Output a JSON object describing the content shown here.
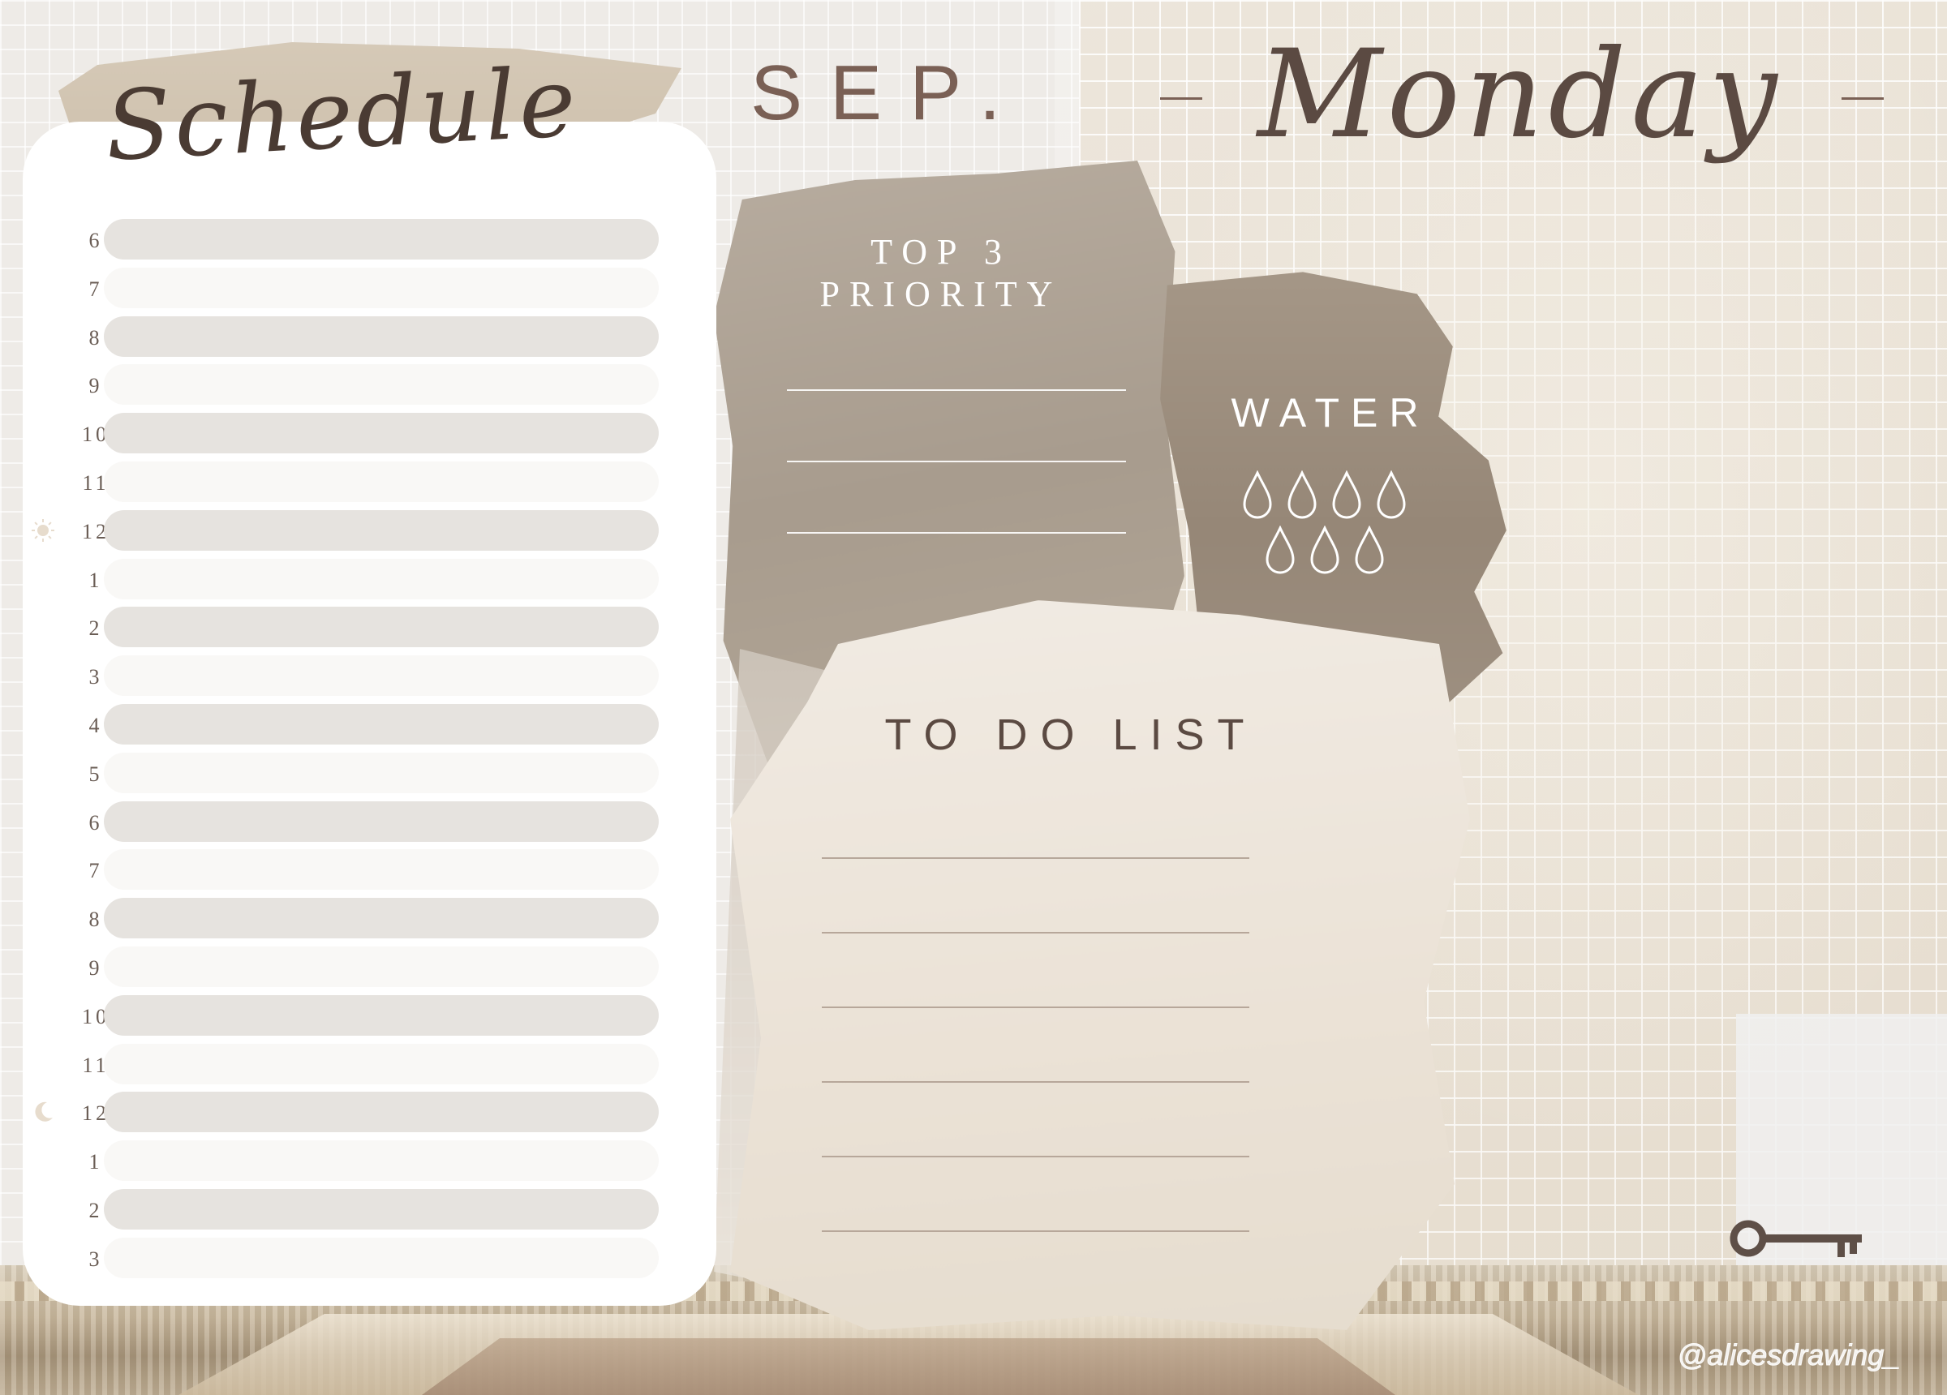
{
  "header": {
    "month": "SEP.",
    "day": "Monday",
    "schedule_title": "Schedule"
  },
  "schedule": {
    "hours": [
      "6",
      "7",
      "8",
      "9",
      "10",
      "11",
      "12",
      "1",
      "2",
      "3",
      "4",
      "5",
      "6",
      "7",
      "8",
      "9",
      "10",
      "11",
      "12",
      "1",
      "2",
      "3"
    ],
    "sun_marker_hour_index": 6,
    "moon_marker_hour_index": 18
  },
  "priority": {
    "title_line1": "TOP 3",
    "title_line2": "PRIORITY",
    "line_count": 3
  },
  "water": {
    "title": "WATER",
    "drop_count": 7
  },
  "todo": {
    "title": "TO DO LIST",
    "line_count": 6
  },
  "footer": {
    "watermark": "@alicesdrawing_",
    "key_icon": "key-icon"
  },
  "colors": {
    "text_brown": "#5b4a42",
    "bar_dark": "#e6e3df",
    "bar_light": "#f9f8f6",
    "card": "#ffffff"
  }
}
